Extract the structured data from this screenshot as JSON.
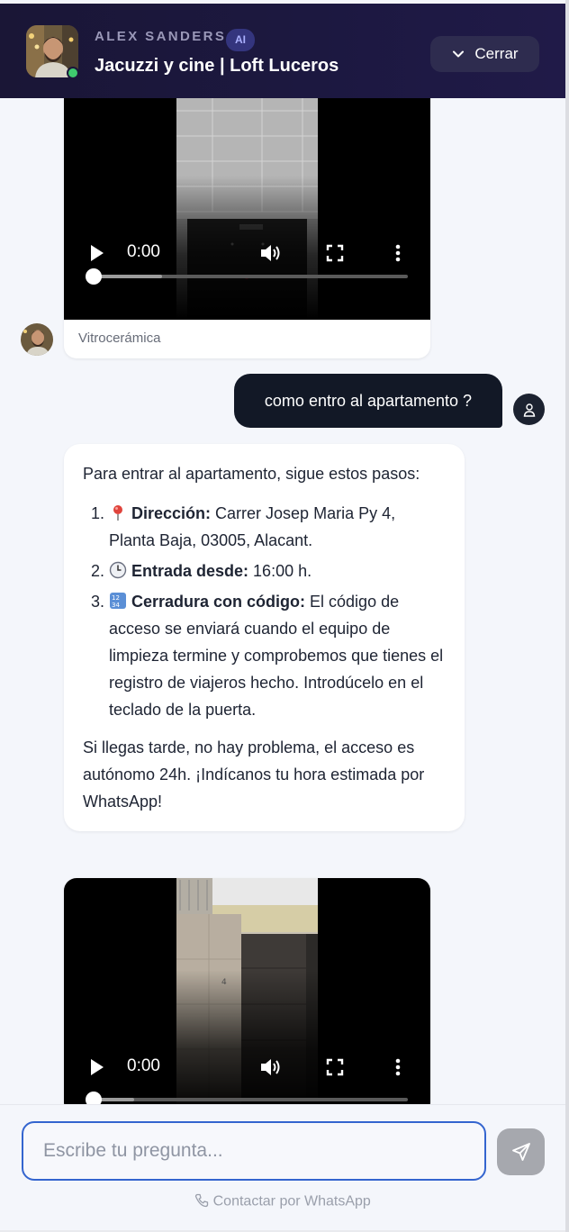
{
  "header": {
    "host_name": "ALEX SANDERS",
    "ai_badge": "AI",
    "listing_title": "Jacuzzi y cine | Loft Luceros",
    "close_label": "Cerrar",
    "avatar_icon": "host-photo",
    "status": "online"
  },
  "chat": {
    "video_1": {
      "time": "0:00",
      "caption": "Vitrocerámica",
      "progress_buffered": 0.22
    },
    "user_message": "como entro al apartamento ?",
    "bot_message": {
      "intro": "Para entrar al apartamento, sigue estos pasos:",
      "steps": [
        {
          "icon": "📍",
          "title": "Dirección:",
          "text": " Carrer Josep Maria Py 4, Planta Baja, 03005, Alacant."
        },
        {
          "icon": "🕒",
          "title": "Entrada desde:",
          "text": " 16:00 h."
        },
        {
          "icon": "🔢",
          "title": "Cerradura con código:",
          "text": " El código de acceso se enviará cuando el equipo de limpieza termine y comprobemos que tienes el registro de viajeros hecho. Introdúcelo en el teclado de la puerta."
        }
      ],
      "outro": "Si llegas tarde, no hay problema, el acceso es autónomo 24h. ¡Indícanos tu hora estimada por WhatsApp!"
    },
    "video_2": {
      "time": "0:00",
      "progress_buffered": 0.13
    }
  },
  "composer": {
    "placeholder": "Escribe tu pregunta...",
    "whatsapp_label": "Contactar por WhatsApp"
  },
  "colors": {
    "header_bg": "#1a1636",
    "user_bubble": "#121826",
    "input_border": "#3465cf",
    "online": "#3fca6e"
  }
}
